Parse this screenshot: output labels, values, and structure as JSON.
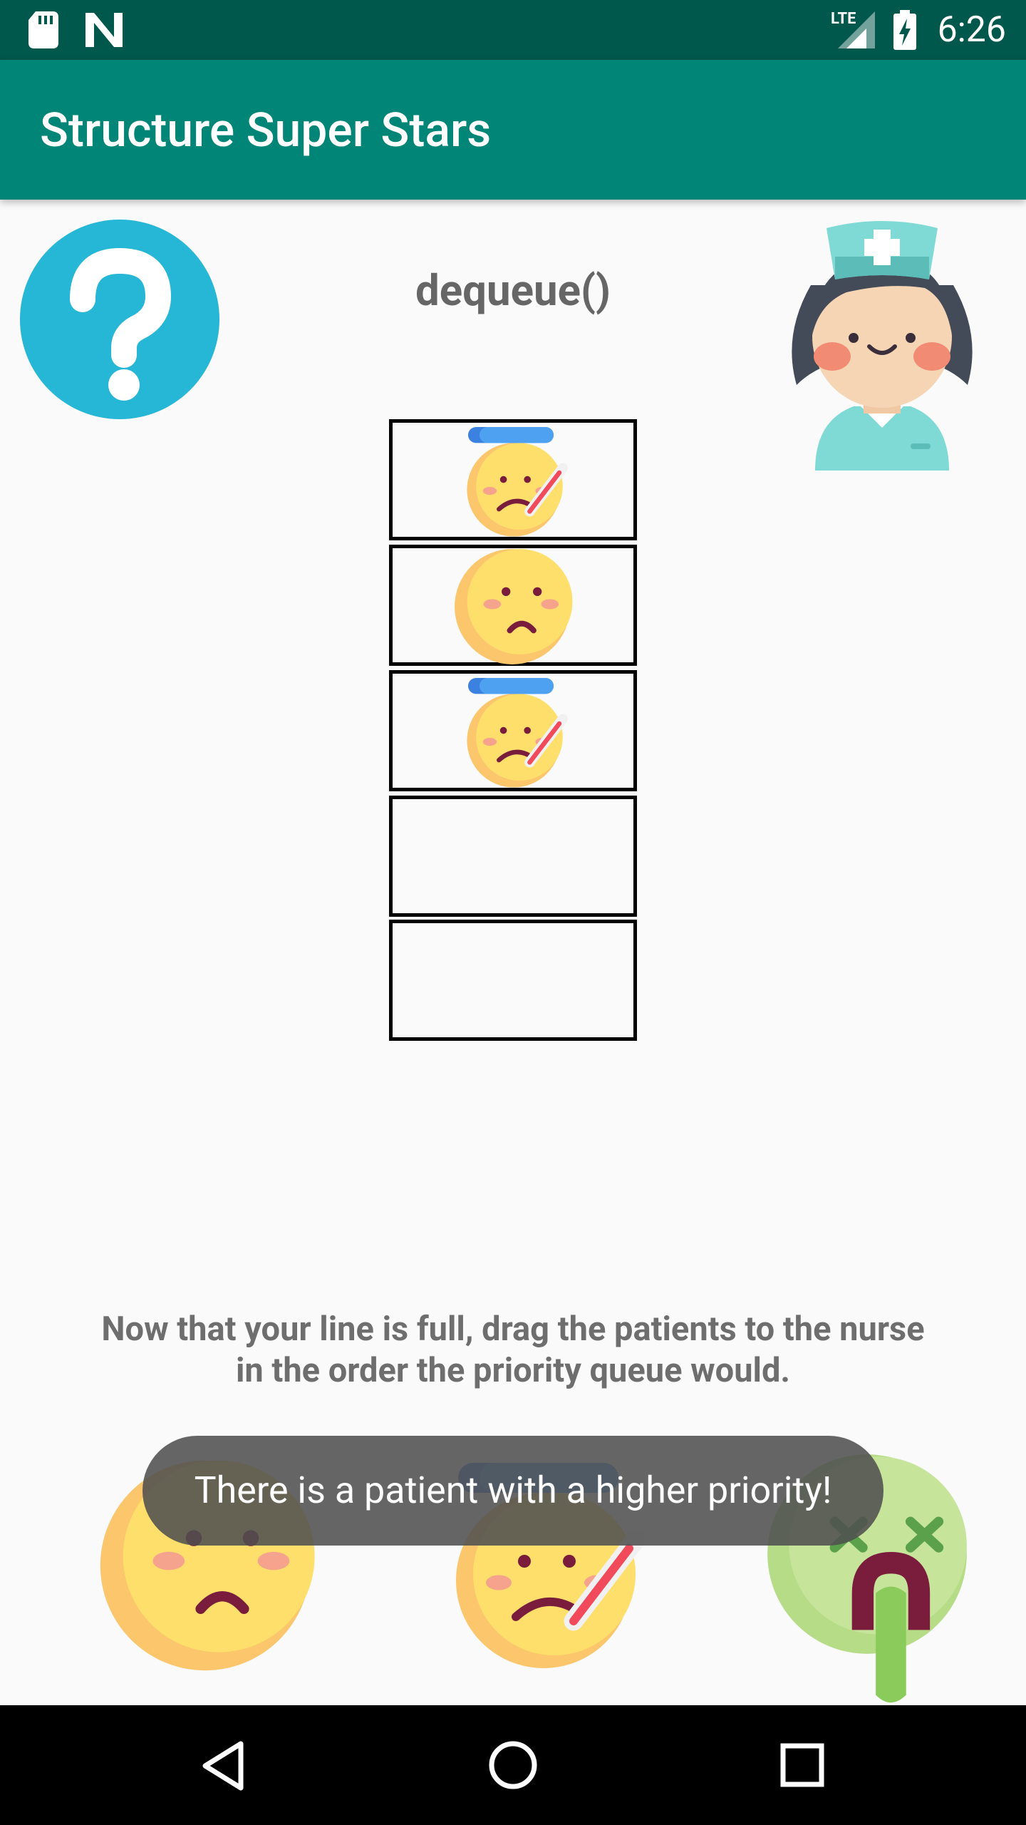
{
  "status_bar": {
    "time": "6:26",
    "network": "LTE"
  },
  "app_bar": {
    "title": "Structure Super Stars"
  },
  "game": {
    "operation": "dequeue()",
    "queue_slots": [
      {
        "patient": "sick-thermometer"
      },
      {
        "patient": "sad"
      },
      {
        "patient": "sick-thermometer"
      },
      {
        "patient": "empty"
      },
      {
        "patient": "empty"
      }
    ],
    "instruction_line1": "Now that your line is full, drag the patients to the nurse",
    "instruction_line2": "in the order the priority queue would.",
    "toast": "There is a patient with a higher priority!",
    "waiting_patients": [
      "sad",
      "sick-thermometer",
      "nauseated"
    ]
  },
  "colors": {
    "status_bar": "#00574B",
    "app_bar": "#008577",
    "help_button": "#26B6D6",
    "face_yellow": "#FFDF6B",
    "zombie_green": "#C6E49A"
  },
  "icons": {
    "help": "question-mark-icon",
    "nurse": "nurse-icon",
    "nav_back": "back-triangle-icon",
    "nav_home": "home-circle-icon",
    "nav_recents": "recents-square-icon"
  }
}
